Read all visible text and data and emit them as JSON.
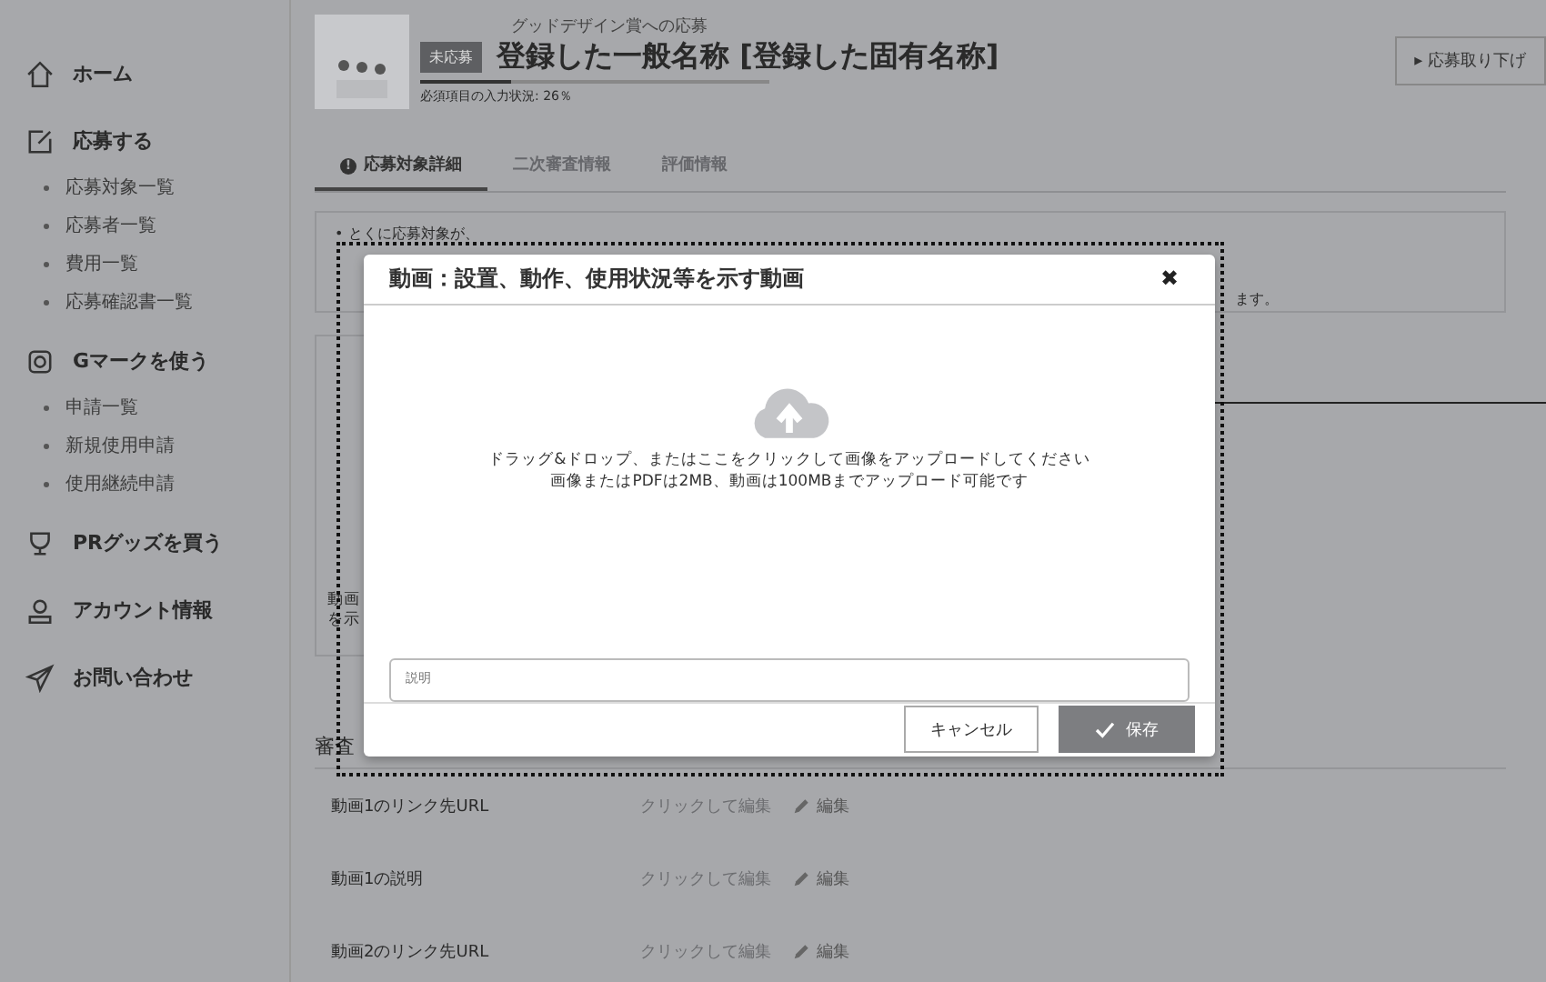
{
  "sidebar": {
    "items": [
      {
        "kind": "main",
        "label": "ホーム"
      },
      {
        "kind": "main",
        "label": "応募する"
      },
      {
        "kind": "sub",
        "label": "応募対象一覧"
      },
      {
        "kind": "sub",
        "label": "応募者一覧"
      },
      {
        "kind": "sub",
        "label": "費用一覧"
      },
      {
        "kind": "sub",
        "label": "応募確認書一覧"
      },
      {
        "kind": "main",
        "label": "Gマークを使う"
      },
      {
        "kind": "sub",
        "label": "申請一覧"
      },
      {
        "kind": "sub",
        "label": "新規使用申請"
      },
      {
        "kind": "sub",
        "label": "使用継続申請"
      },
      {
        "kind": "main",
        "label": "PRグッズを買う"
      },
      {
        "kind": "main",
        "label": "アカウント情報"
      },
      {
        "kind": "main",
        "label": "お問い合わせ"
      }
    ]
  },
  "header": {
    "status_badge": "未応募",
    "subtitle": "グッドデザイン賞への応募",
    "title": "登録した一般名称 [登録した固有名称]",
    "progress": {
      "level": 0.26,
      "label": "必須項目の入力状況: 26％"
    },
    "withdraw_button": "▸ 応募取り下げ"
  },
  "tabs": [
    {
      "icon_text": "!",
      "label": "応募対象詳細",
      "selected": true
    },
    {
      "label": "二次審査情報",
      "selected": false
    },
    {
      "label": "評価情報",
      "selected": false
    }
  ],
  "notice": {
    "lines": [
      "• とくに応募対象が、",
      "ます。"
    ]
  },
  "partial_label": [
    "動画",
    "を示"
  ],
  "section_heading": "審査",
  "rows": [
    {
      "label": "動画1のリンク先URL",
      "value": "クリックして編集",
      "edit": "編集"
    },
    {
      "label": "動画1の説明",
      "value": "クリックして編集",
      "edit": "編集"
    },
    {
      "label": "動画2のリンク先URL",
      "value": "クリックして編集",
      "edit": "編集"
    }
  ],
  "modal": {
    "title": "動画：設置、動作、使用状況等を示す動画",
    "close": "✖",
    "upload_lines": [
      "ドラッグ&ドロップ、またはここをクリックして画像をアップロードしてください",
      "画像またはPDFは2MB、動画は100MBまでアップロード可能です"
    ],
    "description": {
      "placeholder": "説明"
    },
    "cancel_button": "キャンセル",
    "save_button": "保存"
  }
}
